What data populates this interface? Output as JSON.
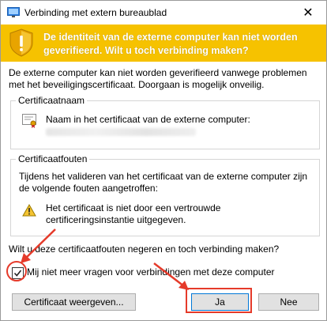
{
  "window": {
    "title": "Verbinding met extern bureaublad",
    "close_glyph": "✕"
  },
  "banner": {
    "text": "De identiteit van de externe computer kan niet worden geverifieerd. Wilt u toch verbinding maken?",
    "color": "#f6c200"
  },
  "intro_text": "De externe computer kan niet worden geverifieerd vanwege problemen met het beveiligingscertificaat. Doorgaan is mogelijk onveilig.",
  "certificate_name": {
    "legend": "Certificaatnaam",
    "label": "Naam in het certificaat van de externe computer:"
  },
  "certificate_errors": {
    "legend": "Certificaatfouten",
    "description": "Tijdens het valideren van het certificaat van de externe computer zijn de volgende fouten aangetroffen:",
    "error_text": "Het certificaat is niet door een vertrouwde certificeringsinstantie uitgegeven."
  },
  "question": "Wilt u deze certificaatfouten negeren en toch verbinding maken?",
  "dont_ask": {
    "label": "Mij niet meer vragen voor verbindingen met deze computer",
    "checked": true
  },
  "buttons": {
    "view_certificate": "Certificaat weergeven...",
    "yes": "Ja",
    "no": "Nee"
  },
  "annotation_color": "#e53a2a"
}
